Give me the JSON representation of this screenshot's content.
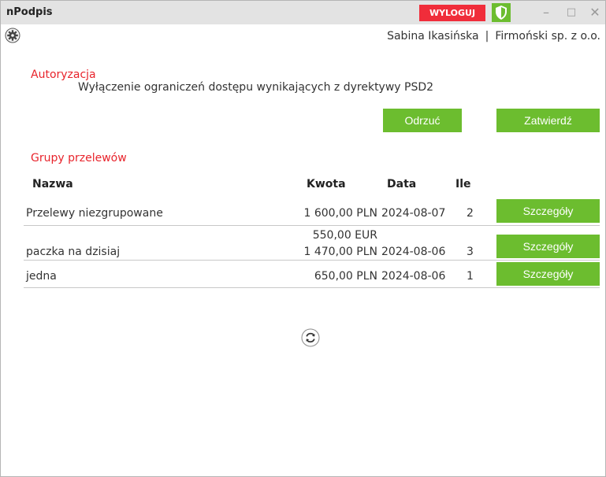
{
  "window": {
    "title": "nPodpis",
    "logout_label": "WYLOGUJ",
    "minimize_glyph": "–",
    "maximize_glyph": "□",
    "close_glyph": "✕"
  },
  "toolbar": {
    "user_name": "Sabina Ikasińska",
    "separator": "|",
    "company": "Firmoński sp. z o.o."
  },
  "authorization": {
    "title": "Autoryzacja",
    "description": "Wyłączenie ograniczeń dostępu wynikających z dyrektywy PSD2",
    "reject_label": "Odrzuć",
    "confirm_label": "Zatwierdź"
  },
  "groups": {
    "title": "Grupy przelewów",
    "columns": {
      "name": "Nazwa",
      "amount": "Kwota",
      "date": "Data",
      "count": "Ile"
    },
    "rows": [
      {
        "name": "Przelewy niezgrupowane",
        "amount_1": "",
        "amount_2": "1 600,00 PLN",
        "date": "2024-08-07",
        "count": "2",
        "details_label": "Szczegóły"
      },
      {
        "name": "paczka na dzisiaj",
        "amount_1": "550,00 EUR",
        "amount_2": "1 470,00 PLN",
        "date": "2024-08-06",
        "count": "3",
        "details_label": "Szczegóły"
      },
      {
        "name": "jedna",
        "amount_1": "",
        "amount_2": "650,00 PLN",
        "date": "2024-08-06",
        "count": "1",
        "details_label": "Szczegóły"
      }
    ]
  },
  "icons": {
    "shield": "shield-icon",
    "settings": "gear-icon",
    "refresh": "refresh-icon"
  },
  "colors": {
    "accent_green": "#6cbd2f",
    "logout_red": "#f02d3a",
    "section_red": "#e8242c",
    "titlebar_gray": "#e3e3e3"
  }
}
